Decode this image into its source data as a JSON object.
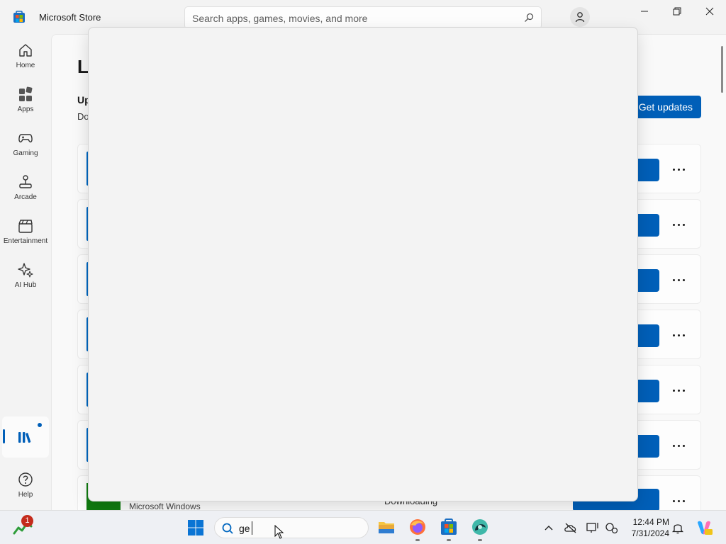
{
  "window": {
    "title": "Microsoft Store",
    "search_placeholder": "Search apps, games, movies, and more"
  },
  "nav": {
    "items": [
      {
        "label": "Home",
        "icon": "home-icon"
      },
      {
        "label": "Apps",
        "icon": "apps-icon"
      },
      {
        "label": "Gaming",
        "icon": "gamepad-icon"
      },
      {
        "label": "Arcade",
        "icon": "joystick-icon"
      },
      {
        "label": "Entertainment",
        "icon": "clapperboard-icon"
      },
      {
        "label": "AI Hub",
        "icon": "sparkle-icon"
      }
    ],
    "library_icon": "library-icon",
    "help_label": "Help"
  },
  "main": {
    "title_partial": "Li",
    "updates_title_partial": "Up",
    "updates_sub_partial": "Do",
    "get_updates_label": "Get updates",
    "last_row": {
      "publisher": "Microsoft Windows",
      "status": "Downloading"
    }
  },
  "taskbar": {
    "badge_count": "1",
    "search_text": "ge",
    "time": "12:44 PM",
    "date": "7/31/2024",
    "pinned": [
      "file-explorer-icon",
      "firefox-icon",
      "microsoft-store-icon",
      "edge-canary-icon"
    ]
  },
  "colors": {
    "accent": "#005fb8",
    "badge": "#c42b1c"
  }
}
